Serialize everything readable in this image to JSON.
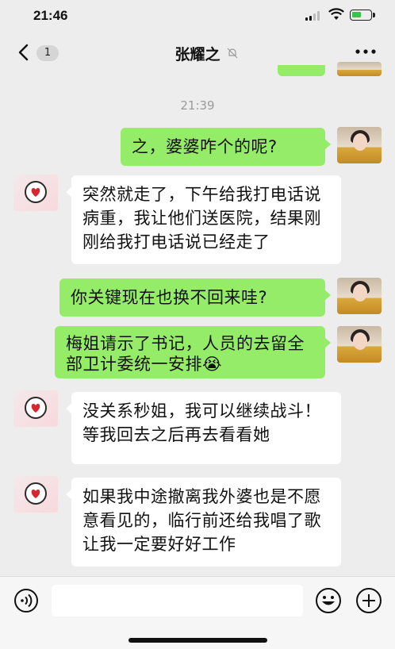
{
  "status_bar": {
    "time": "21:46"
  },
  "header": {
    "back_count": "1",
    "contact_name": "张耀之",
    "mute_icon": "bell-off-icon",
    "more_icon": "more-icon"
  },
  "chat": {
    "timestamp": "21:39",
    "messages": [
      {
        "from": "me",
        "text": "之，婆婆咋个的呢?"
      },
      {
        "from": "them",
        "text": "突然就走了，下午给我打电话说病重，我让他们送医院，结果刚刚给我打电话说已经走了"
      },
      {
        "from": "me",
        "text": "你关键现在也换不回来哇?"
      },
      {
        "from": "me",
        "text": "梅姐请示了书记，人员的去留全部卫计委统一安排😭"
      },
      {
        "from": "them",
        "text": "没关系秒姐，我可以继续战斗！等我回去之后再去看看她"
      },
      {
        "from": "them",
        "text": "如果我中途撤离我外婆也是不愿意看见的，临行前还给我唱了歌让我一定要好好工作"
      }
    ]
  },
  "input_bar": {
    "voice_icon": "voice-icon",
    "emoji_icon": "emoji-icon",
    "plus_icon": "plus-icon",
    "message_value": ""
  },
  "colors": {
    "my_bubble": "#95ec69",
    "their_bubble": "#ffffff",
    "background": "#ededed"
  }
}
